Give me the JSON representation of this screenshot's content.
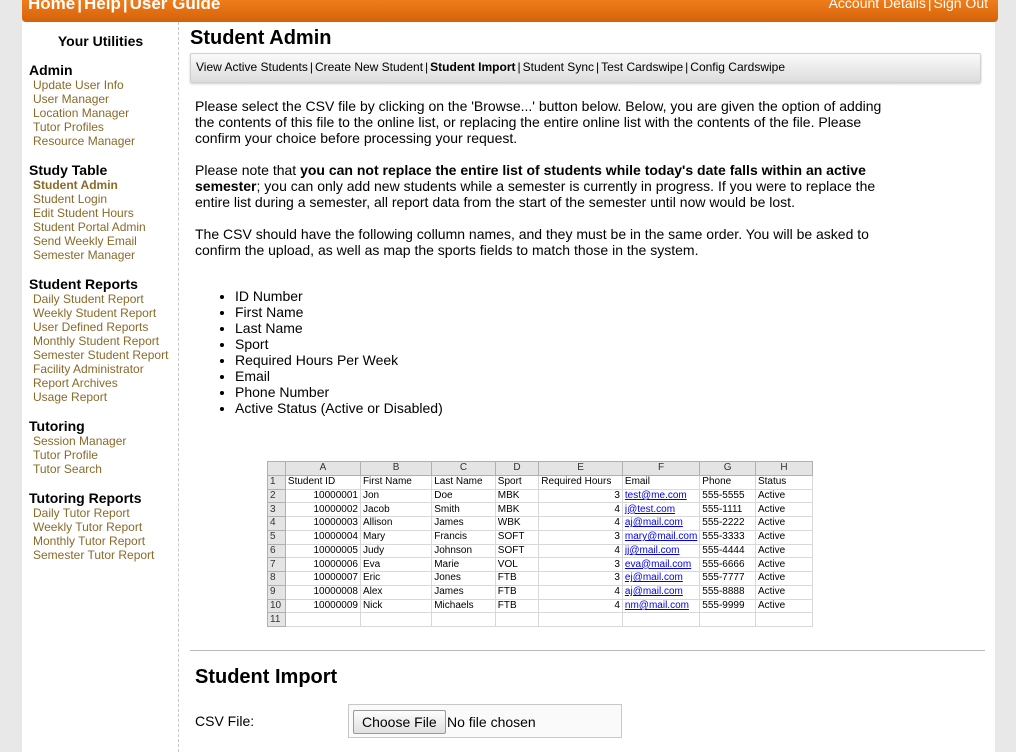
{
  "topbar": {
    "home": "Home",
    "help": "Help",
    "user_guide": "User Guide",
    "account_details": "Account Details",
    "sign_out": "Sign Out"
  },
  "sidebar": {
    "title": "Your Utilities",
    "sections": [
      {
        "title": "Admin",
        "items": [
          "Update User Info",
          "User Manager",
          "Location Manager",
          "Tutor Profiles",
          "Resource Manager"
        ]
      },
      {
        "title": "Study Table",
        "items": [
          "Student Admin",
          "Student Login",
          "Edit Student Hours",
          "Student Portal Admin",
          "Send Weekly Email",
          "Semester Manager"
        ]
      },
      {
        "title": "Student Reports",
        "items": [
          "Daily Student Report",
          "Weekly Student Report",
          "User Defined Reports",
          "Monthly Student Report",
          "Semester Student Report",
          "Facility Administrator",
          "Report Archives",
          "Usage Report"
        ]
      },
      {
        "title": "Tutoring",
        "items": [
          "Session Manager",
          "Tutor Profile",
          "Tutor Search"
        ]
      },
      {
        "title": "Tutoring Reports",
        "items": [
          "Daily Tutor Report",
          "Weekly Tutor Report",
          "Monthly Tutor Report",
          "Semester Tutor Report"
        ]
      }
    ]
  },
  "main": {
    "title": "Student Admin",
    "subnav": [
      "View Active Students",
      "Create New Student",
      "Student Import",
      "Student Sync",
      "Test Cardswipe",
      "Config Cardswipe"
    ],
    "para1": "Please select the CSV file by clicking on the 'Browse...' button below. Below, you are given the option of adding the contents of this file to the online list, or replacing the entire online list with the contents of the file. Please confirm your choice before processing your request.",
    "para2_pre": "Please note that ",
    "para2_bold": "you can not replace the entire list of students while today's date falls within an active semester",
    "para2_post": "; you can only add new students while a semester is currently in progress. If you were to replace the entire list during a semester, all report data from the start of the semester until now would be lost.",
    "para3": "The CSV should have the following collumn names, and they must be in the same order. You will be asked to confirm the upload, as well as map the sports fields to match those in the system.",
    "columns": [
      "ID Number",
      "First Name",
      "Last Name",
      "Sport",
      "Required Hours Per Week",
      "Email",
      "Phone Number",
      "Active Status (Active or Disabled)"
    ]
  },
  "sheet": {
    "col_letters": [
      "A",
      "B",
      "C",
      "D",
      "E",
      "F",
      "G",
      "H"
    ],
    "header": [
      "Student ID",
      "First Name",
      "Last Name",
      "Sport",
      "Required Hours",
      "Email",
      "Phone",
      "Status"
    ],
    "rows": [
      [
        "10000001",
        "Jon",
        "Doe",
        "MBK",
        "3",
        "test@me.com",
        "555-5555",
        "Active"
      ],
      [
        "10000002",
        "Jacob",
        "Smith",
        "MBK",
        "4",
        "j@test.com",
        "555-1111",
        "Active"
      ],
      [
        "10000003",
        "Allison",
        "James",
        "WBK",
        "4",
        "aj@mail.com",
        "555-2222",
        "Active"
      ],
      [
        "10000004",
        "Mary",
        "Francis",
        "SOFT",
        "3",
        "mary@mail.com",
        "555-3333",
        "Active"
      ],
      [
        "10000005",
        "Judy",
        "Johnson",
        "SOFT",
        "4",
        "jj@mail.com",
        "555-4444",
        "Active"
      ],
      [
        "10000006",
        "Eva",
        "Marie",
        "VOL",
        "3",
        "eva@mail.com",
        "555-6666",
        "Active"
      ],
      [
        "10000007",
        "Eric",
        "Jones",
        "FTB",
        "3",
        "ej@mail.com",
        "555-7777",
        "Active"
      ],
      [
        "10000008",
        "Alex",
        "James",
        "FTB",
        "4",
        "aj@mail.com",
        "555-8888",
        "Active"
      ],
      [
        "10000009",
        "Nick",
        "Michaels",
        "FTB",
        "4",
        "nm@mail.com",
        "555-9999",
        "Active"
      ]
    ]
  },
  "import": {
    "title": "Student Import",
    "csv_label": "CSV File:",
    "choose_button": "Choose File",
    "status": "No file chosen"
  }
}
